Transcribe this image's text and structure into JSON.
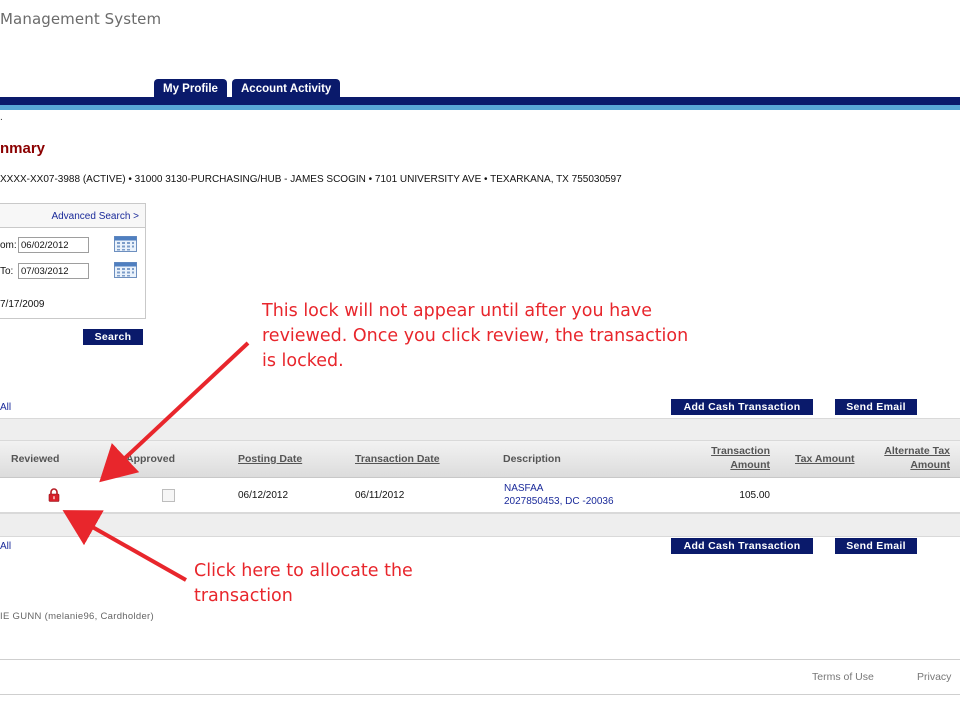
{
  "app": {
    "title": "Management System"
  },
  "tabs": [
    {
      "label": "My Profile"
    },
    {
      "label": "Account Activity"
    }
  ],
  "breadcrumb": ".",
  "page_heading": "nmary",
  "account_line": "XXXX-XX07-3988 (ACTIVE) • 31000 3130-PURCHASING/HUB - JAMES SCOGIN • 7101 UNIVERSITY AVE • TEXARKANA, TX 755030597",
  "filter": {
    "advanced_search": "Advanced Search >",
    "from_label": "om:",
    "from_value": "06/02/2012",
    "to_label": "To:",
    "to_value": "07/03/2012",
    "since_text": "7/17/2009",
    "search_button": "Search"
  },
  "actions": {
    "select_all": "All",
    "add_cash": "Add Cash Transaction",
    "send_email": "Send Email"
  },
  "table": {
    "columns": {
      "reviewed": "Reviewed",
      "approved": "Approved",
      "posting_date": "Posting Date",
      "transaction_date": "Transaction Date",
      "description": "Description",
      "transaction_amount_1": "Transaction",
      "transaction_amount_2": "Amount",
      "tax_amount": "Tax Amount",
      "alt_tax_1": "Alternate Tax",
      "alt_tax_2": "Amount"
    },
    "rows": [
      {
        "posting_date": "06/12/2012",
        "transaction_date": "06/11/2012",
        "description_line1": "NASFAA",
        "description_line2": "2027850453, DC -20036",
        "amount": "105.00"
      }
    ]
  },
  "annotations": {
    "lock_note": "This lock will not appear until after you have reviewed. Once you click review, the transaction is locked.",
    "click_note": "Click here to allocate the transaction"
  },
  "user_line": "IE GUNN (melanie96, Cardholder)",
  "footer": {
    "terms": "Terms of Use",
    "privacy": "Privacy"
  },
  "colors": {
    "navy": "#0a1a6b",
    "accent_blue": "#58a7d6",
    "heading_red": "#8b0000",
    "annotation_red": "#e8262c",
    "lock_red": "#d8202a"
  },
  "icons": [
    "calendar-icon",
    "lock-icon"
  ]
}
